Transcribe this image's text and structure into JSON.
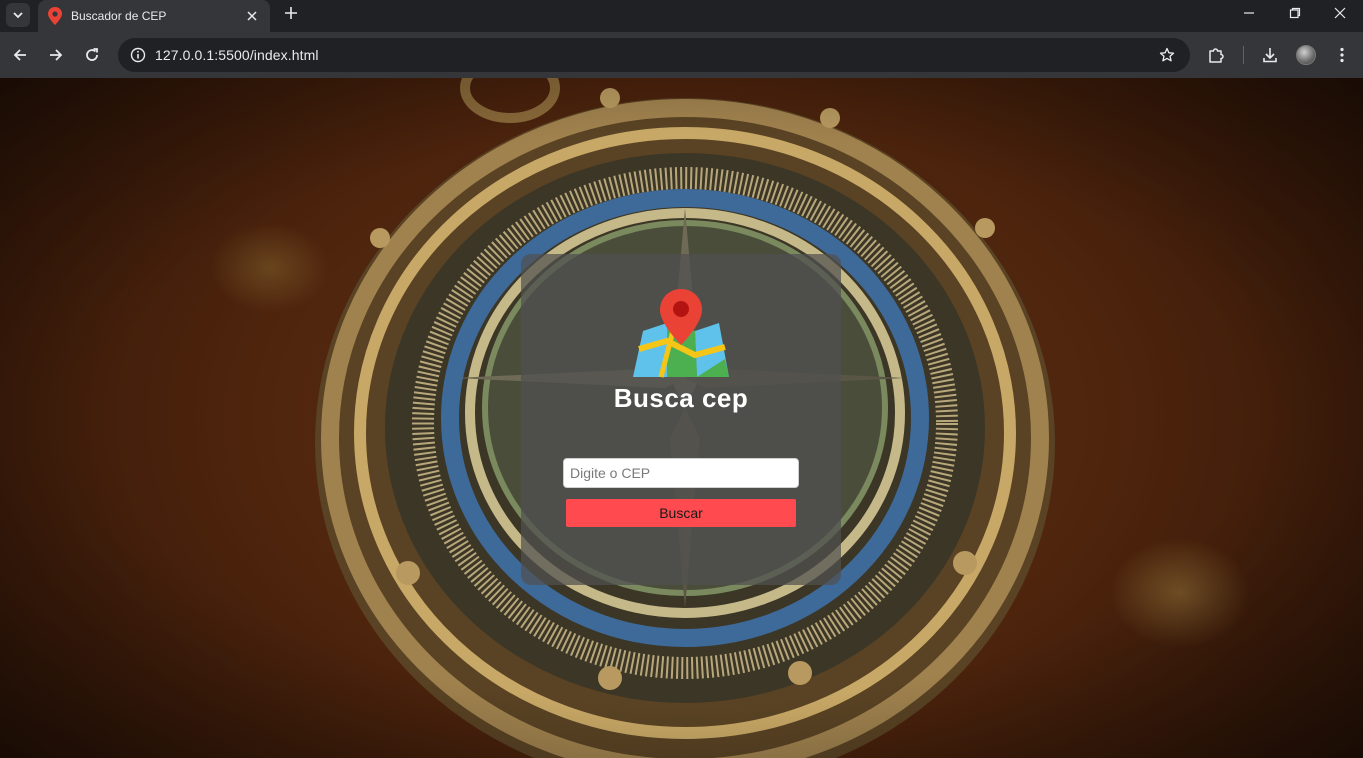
{
  "browser": {
    "tab_title": "Buscador de CEP",
    "url": "127.0.0.1:5500/index.html",
    "icons": {
      "tab_search": "chevron-down-icon",
      "favicon": "map-pin-icon",
      "close": "close-icon",
      "new_tab": "plus-icon",
      "back": "back-arrow-icon",
      "forward": "forward-arrow-icon",
      "reload": "reload-icon",
      "site_info": "info-icon",
      "bookmark": "star-icon",
      "extensions": "puzzle-icon",
      "downloads": "download-icon",
      "menu": "kebab-menu-icon"
    }
  },
  "page": {
    "title": "Busca cep",
    "cep_input": {
      "placeholder": "Digite o CEP",
      "value": ""
    },
    "search_button_label": "Buscar",
    "colors": {
      "button": "#ff4a4f",
      "pin": "#ea4335",
      "card": "rgba(80,80,80,0.72)"
    }
  }
}
